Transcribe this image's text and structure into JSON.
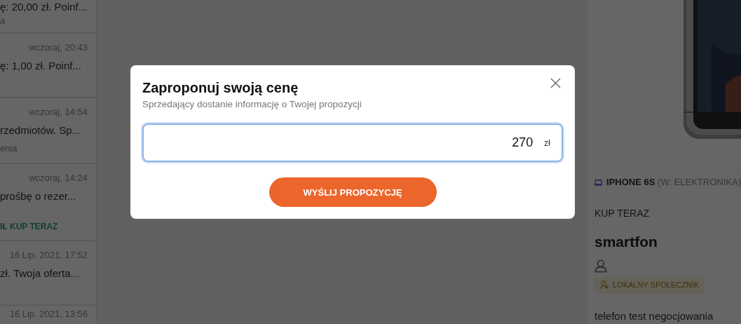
{
  "messages": [
    {
      "preview": "ę: 20,00 zł. Poinf...",
      "note": "a"
    },
    {
      "date": "wczoraj, 20:43",
      "preview": "ę: 1,00 zł. Poinf..."
    },
    {
      "date": "wczoraj, 14:54",
      "preview": "rzedmiotów. Sp...",
      "note": "enia"
    },
    {
      "date": "wczoraj, 14:24",
      "preview": "prośbę o rezer...",
      "status": "IŁ KUP TERAZ"
    },
    {
      "date": "16 Lip. 2021, 17:52",
      "preview": "zł. Twoja oferta..."
    },
    {
      "date": "16 Lip. 2021, 13:56"
    }
  ],
  "listing": {
    "category": "IPHONE 6S",
    "category_parent": "(W: ELEKTRONIKA)",
    "type": "KUP TERAZ",
    "title": "smartfon",
    "badge": "LOKALNY SPOŁECZNIK",
    "description": "telefon test negocjowania"
  },
  "modal": {
    "title": "Zaproponuj swoją cenę",
    "subtitle": "Sprzedający dostanie informację o Twojej propozycji",
    "price": "270",
    "currency": "zł",
    "submit": "WYŚLIJ PROPOZYCJĘ"
  }
}
